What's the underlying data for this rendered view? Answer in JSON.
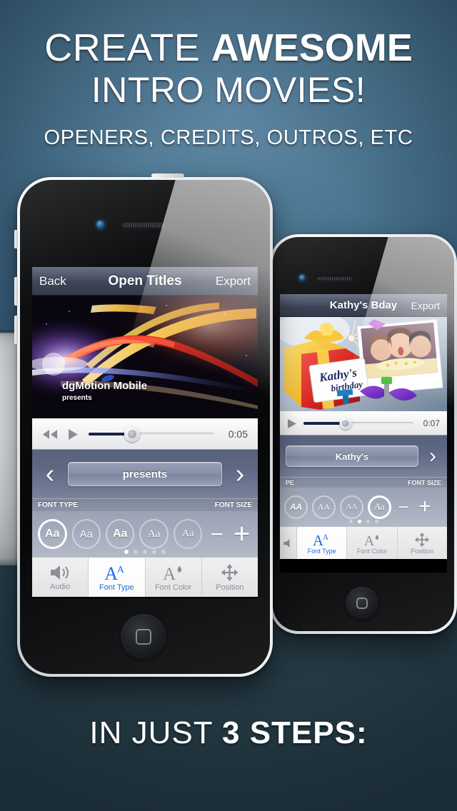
{
  "promo": {
    "headline_line1_light": "CREATE",
    "headline_line1_bold": "AWESOME",
    "headline_line2": "INTRO MOVIES!",
    "subheadline": "OPENERS, CREDITS, OUTROS, ETC",
    "footer_light": "IN JUST",
    "footer_bold": "3 STEPS:",
    "accent_color": "#1a6fe0",
    "background_top_color": "#4b7590",
    "background_bottom_color": "#2b424d"
  },
  "phone_front": {
    "device": "iphone-white",
    "navbar": {
      "back_label": "Back",
      "title": "Open Titles",
      "export_label": "Export"
    },
    "preview": {
      "title_text": "dgMotion Mobile",
      "subtitle_text": "presents",
      "artwork": "abstract-light-streaks"
    },
    "transport": {
      "rewind_icon": "rewind-icon",
      "play_icon": "play-icon",
      "progress_percent": 35,
      "time_label": "0:05"
    },
    "editor": {
      "prev_icon": "chevron-left-icon",
      "next_icon": "chevron-right-icon",
      "text_value": "presents"
    },
    "font_strip": {
      "left_label": "FONT TYPE",
      "right_label": "FONT SIZE",
      "decrease_label": "−",
      "increase_label": "+",
      "options": [
        {
          "label": "Aa",
          "style": "sans-bold",
          "selected": true
        },
        {
          "label": "Aa",
          "style": "sans-regular",
          "selected": false
        },
        {
          "label": "Aa",
          "style": "sans-bold2",
          "selected": false
        },
        {
          "label": "Aa",
          "style": "serif",
          "selected": false
        },
        {
          "label": "Aa",
          "style": "serif-light",
          "selected": false
        }
      ],
      "page_count": 5,
      "page_active": 1
    },
    "tabs": [
      {
        "label": "Audio",
        "icon": "speaker-icon",
        "active": false
      },
      {
        "label": "Font Type",
        "icon": "font-type-icon",
        "active": true
      },
      {
        "label": "Font Color",
        "icon": "font-color-icon",
        "active": false
      },
      {
        "label": "Position",
        "icon": "move-arrows-icon",
        "active": false
      }
    ]
  },
  "phone_back": {
    "device": "iphone-white",
    "navbar": {
      "title": "Kathy's Bday",
      "export_label": "Export"
    },
    "preview": {
      "card_line1": "Kathy's",
      "card_line2": "birthday",
      "artwork": "birthday-gift-photo"
    },
    "transport": {
      "play_icon": "play-icon",
      "progress_percent": 38,
      "time_label": "0:07"
    },
    "editor": {
      "next_icon": "chevron-right-icon",
      "text_value": "Kathy's"
    },
    "font_strip": {
      "left_label": "PE",
      "right_label": "FONT SIZE",
      "decrease_label": "−",
      "increase_label": "+",
      "options": [
        {
          "label": "AA",
          "style": "bold-italic",
          "selected": false
        },
        {
          "label": "AA",
          "style": "serif-caps",
          "selected": false
        },
        {
          "label": "AA",
          "style": "small-caps",
          "selected": false
        },
        {
          "label": "Aa",
          "style": "italic",
          "selected": true
        }
      ],
      "page_count": 4,
      "page_active": 2
    },
    "tabs": [
      {
        "label": "",
        "icon": "speaker-icon",
        "active": false
      },
      {
        "label": "Font Type",
        "icon": "font-type-icon",
        "active": true
      },
      {
        "label": "Font Color",
        "icon": "font-color-icon",
        "active": false
      },
      {
        "label": "Position",
        "icon": "move-arrows-icon",
        "active": false
      }
    ]
  }
}
